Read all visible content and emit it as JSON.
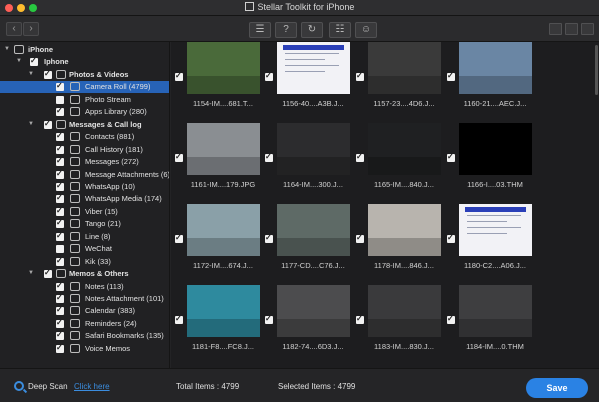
{
  "window": {
    "title": "Stellar Toolkit for iPhone",
    "colors": {
      "close": "#ff5f57",
      "minimize": "#febc2e",
      "maximize": "#28c840",
      "accent": "#2a82e4",
      "selection": "#2763b7"
    }
  },
  "toolbar": {
    "back_icon": "chevron-left-icon",
    "forward_icon": "chevron-right-icon",
    "tools": [
      "scan-icon",
      "help-icon",
      "refresh-icon",
      "cart-icon",
      "account-icon"
    ],
    "tool_glyphs": [
      "☰",
      "?",
      "↻",
      "☷",
      "☺"
    ],
    "view_icons": [
      "grid-view-icon",
      "list-view-icon",
      "cover-view-icon"
    ]
  },
  "sidebar": {
    "items": [
      {
        "label": "iPhone",
        "level": 0,
        "bold": true,
        "checked": false,
        "icon": "device-icon",
        "expanded": true
      },
      {
        "label": "Iphone",
        "level": 1,
        "bold": true,
        "checked": true,
        "icon": "",
        "expanded": true
      },
      {
        "label": "Photos & Videos",
        "level": 2,
        "bold": true,
        "checked": true,
        "icon": "photos-icon",
        "expanded": true
      },
      {
        "label": "Camera Roll (4799)",
        "level": 3,
        "checked": true,
        "icon": "camera-roll-icon",
        "selected": true
      },
      {
        "label": "Photo Stream",
        "level": 3,
        "checked": false,
        "icon": "photo-stream-icon"
      },
      {
        "label": "Apps Library (280)",
        "level": 3,
        "checked": true,
        "icon": "apps-library-icon"
      },
      {
        "label": "Messages & Call log",
        "level": 2,
        "bold": true,
        "checked": true,
        "icon": "messages-call-icon",
        "expanded": true
      },
      {
        "label": "Contacts (881)",
        "level": 3,
        "checked": true,
        "icon": "contacts-icon"
      },
      {
        "label": "Call History (181)",
        "level": 3,
        "checked": true,
        "icon": "call-history-icon"
      },
      {
        "label": "Messages (272)",
        "level": 3,
        "checked": true,
        "icon": "messages-icon"
      },
      {
        "label": "Message Attachments (6)",
        "level": 3,
        "checked": true,
        "icon": "attachment-icon"
      },
      {
        "label": "WhatsApp (10)",
        "level": 3,
        "checked": true,
        "icon": "whatsapp-icon"
      },
      {
        "label": "WhatsApp Media (174)",
        "level": 3,
        "checked": true,
        "icon": "whatsapp-media-icon"
      },
      {
        "label": "Viber (15)",
        "level": 3,
        "checked": true,
        "icon": "viber-icon"
      },
      {
        "label": "Tango (21)",
        "level": 3,
        "checked": true,
        "icon": "tango-icon"
      },
      {
        "label": "Line (8)",
        "level": 3,
        "checked": true,
        "icon": "line-icon"
      },
      {
        "label": "WeChat",
        "level": 3,
        "checked": false,
        "icon": "wechat-icon"
      },
      {
        "label": "Kik (33)",
        "level": 3,
        "checked": true,
        "icon": "kik-icon"
      },
      {
        "label": "Memos & Others",
        "level": 2,
        "bold": true,
        "checked": true,
        "icon": "memos-icon",
        "expanded": true
      },
      {
        "label": "Notes (113)",
        "level": 3,
        "checked": true,
        "icon": "notes-icon"
      },
      {
        "label": "Notes Attachment (101)",
        "level": 3,
        "checked": true,
        "icon": "notes-attachment-icon"
      },
      {
        "label": "Calendar (383)",
        "level": 3,
        "checked": true,
        "icon": "calendar-icon"
      },
      {
        "label": "Reminders (24)",
        "level": 3,
        "checked": true,
        "icon": "reminders-icon"
      },
      {
        "label": "Safari Bookmarks (135)",
        "level": 3,
        "checked": true,
        "icon": "safari-bookmarks-icon"
      },
      {
        "label": "Voice Memos",
        "level": 3,
        "checked": true,
        "icon": "voice-memos-icon"
      }
    ]
  },
  "grid": {
    "items": [
      {
        "name": "1154-IM....681.T...",
        "checked": true,
        "thumb": "#4a6a3a"
      },
      {
        "name": "1156-40....A3B.J...",
        "checked": true,
        "thumb": "#f2f2f6",
        "screen": true
      },
      {
        "name": "1157-23....4D6.J...",
        "checked": true,
        "thumb": "#3a3a3a"
      },
      {
        "name": "1160-21....AEC.J...",
        "checked": true,
        "thumb": "#6a86a4"
      },
      {
        "name": "1161-IM....179.JPG",
        "checked": true,
        "thumb": "#8a8e92"
      },
      {
        "name": "1164-IM....300.J...",
        "checked": true,
        "thumb": "#2c2c2e"
      },
      {
        "name": "1165-IM....840.J...",
        "checked": true,
        "thumb": "#1f2022"
      },
      {
        "name": "1166-I....03.THM",
        "checked": true,
        "thumb": "#000000"
      },
      {
        "name": "1172-IM....674.J...",
        "checked": true,
        "thumb": "#8aa0a8"
      },
      {
        "name": "1177-CD....C76.J...",
        "checked": true,
        "thumb": "#5e6a66"
      },
      {
        "name": "1178-IM....846.J...",
        "checked": true,
        "thumb": "#b8b4ae"
      },
      {
        "name": "1180-C2....A06.J...",
        "checked": true,
        "thumb": "#f2f2f6",
        "screen": true
      },
      {
        "name": "1181-F8....FC8.J...",
        "checked": true,
        "thumb": "#2e8a9e"
      },
      {
        "name": "1182-74....6D3.J...",
        "checked": true,
        "thumb": "#4c4c4e"
      },
      {
        "name": "1183-IM....830.J...",
        "checked": true,
        "thumb": "#3a3a3c"
      },
      {
        "name": "1184-IM....0.THM",
        "checked": true,
        "thumb": "#3e3e40"
      }
    ]
  },
  "footer": {
    "deep_scan_label": "Deep Scan",
    "deep_scan_link": "Click here",
    "total_items": "Total Items : 4799",
    "selected_items": "Selected Items : 4799",
    "save_label": "Save"
  }
}
